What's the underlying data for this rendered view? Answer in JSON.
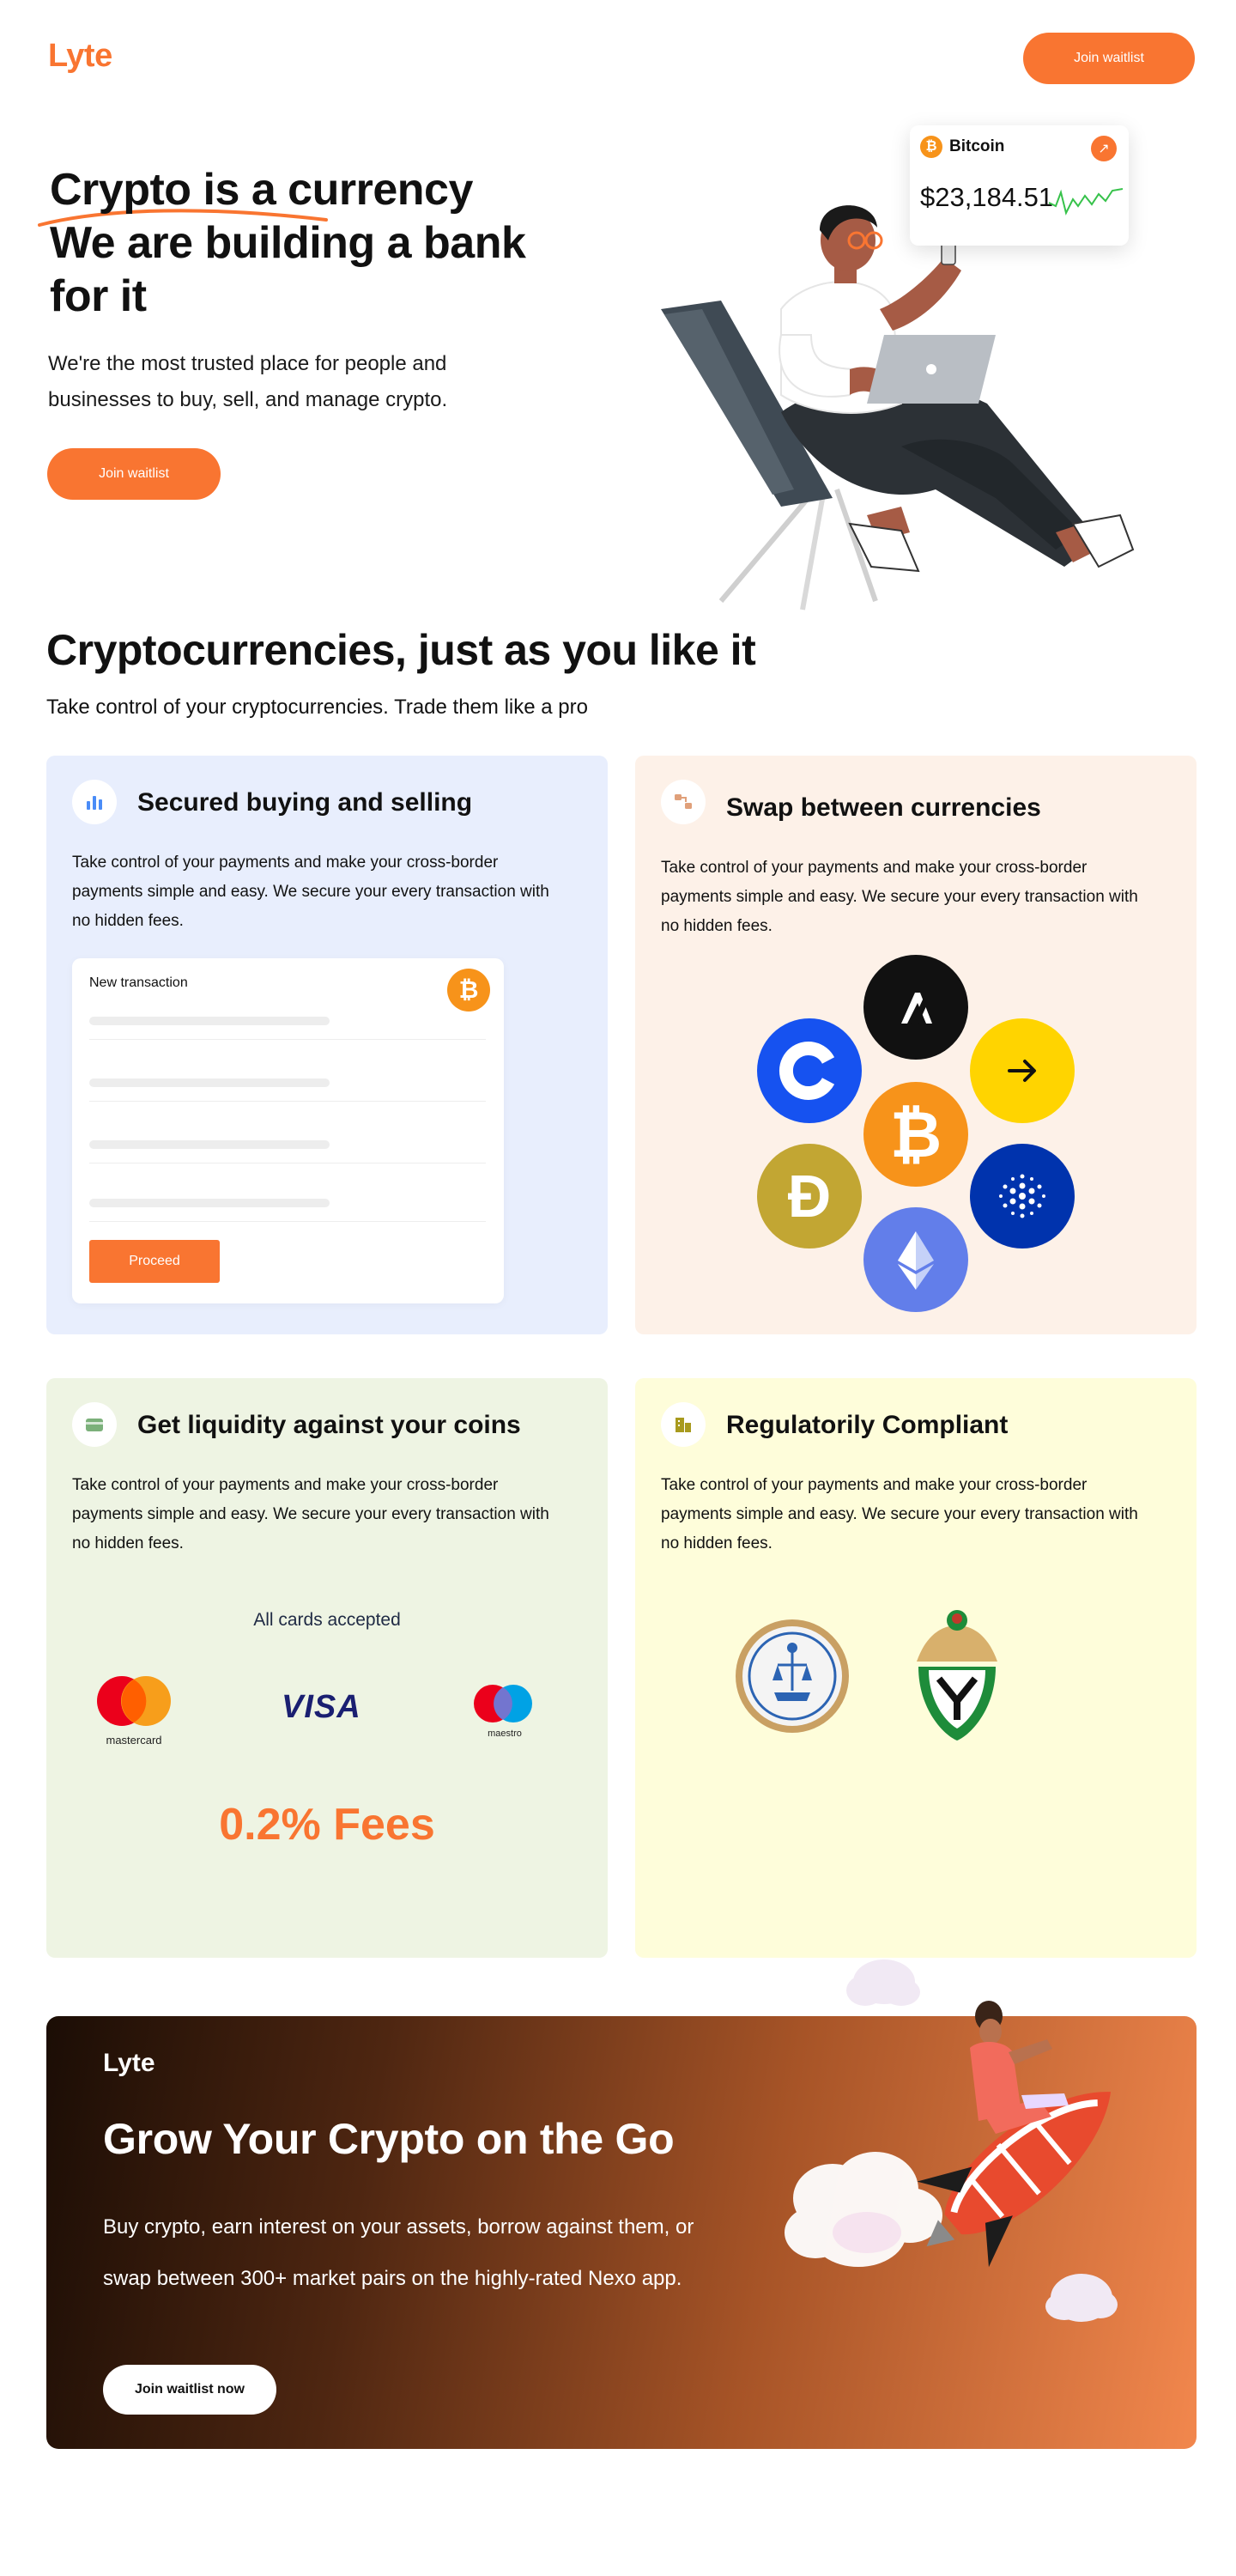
{
  "header": {
    "logo": "Lyte",
    "cta": "Join waitlist"
  },
  "hero": {
    "title_lines": [
      "Crypto is a currency",
      "We are building a bank",
      "for it"
    ],
    "subtitle": "We're the most trusted place for people and businesses to buy, sell, and manage crypto.",
    "cta": "Join waitlist",
    "ticker": {
      "coin_symbol": "₿",
      "name": "Bitcoin",
      "price": "$23,184.51",
      "arrow": "↗"
    }
  },
  "features": {
    "title": "Cryptocurrencies, just as you like it",
    "subtitle": "Take control of your cryptocurrencies. Trade them like a pro",
    "cards": [
      {
        "title": "Secured buying and selling",
        "text": "Take control of your payments and make your cross-border payments simple and easy. We secure your every transaction with no hidden fees.",
        "bg": "#E8EEFD",
        "transaction": {
          "label": "New transaction",
          "coin": "₿",
          "button": "Proceed"
        }
      },
      {
        "title": "Swap between currencies",
        "text": "Take control of your payments and make your cross-border payments simple and easy. We secure your every transaction with no hidden fees.",
        "bg": "#FDF1E8",
        "coins": [
          "algorand",
          "coinbase",
          "bitcoin",
          "arrow-right",
          "dogecoin",
          "cardano",
          "ethereum"
        ]
      },
      {
        "title": "Get liquidity against your coins",
        "text": "Take control of your payments and make your cross-border payments simple and easy. We secure your every transaction with no hidden fees.",
        "bg": "#EEF4E3",
        "cards_label": "All cards accepted",
        "brands": {
          "mastercard": "mastercard",
          "visa": "VISA",
          "maestro": "maestro"
        },
        "fees": "0.2% Fees"
      },
      {
        "title": "Regulatorily Compliant",
        "text": "Take control of your payments and make your cross-border payments simple and easy. We secure your every transaction with no hidden fees.",
        "bg": "#FEFDDA"
      }
    ]
  },
  "banner": {
    "logo": "Lyte",
    "title": "Grow Your Crypto on the Go",
    "text": "Buy crypto, earn interest on your assets, borrow against them, or swap between 300+ market pairs on the highly-rated Nexo app.",
    "cta": "Join waitlist now"
  },
  "colors": {
    "accent": "#F97531",
    "bitcoin": "#F7931A"
  }
}
